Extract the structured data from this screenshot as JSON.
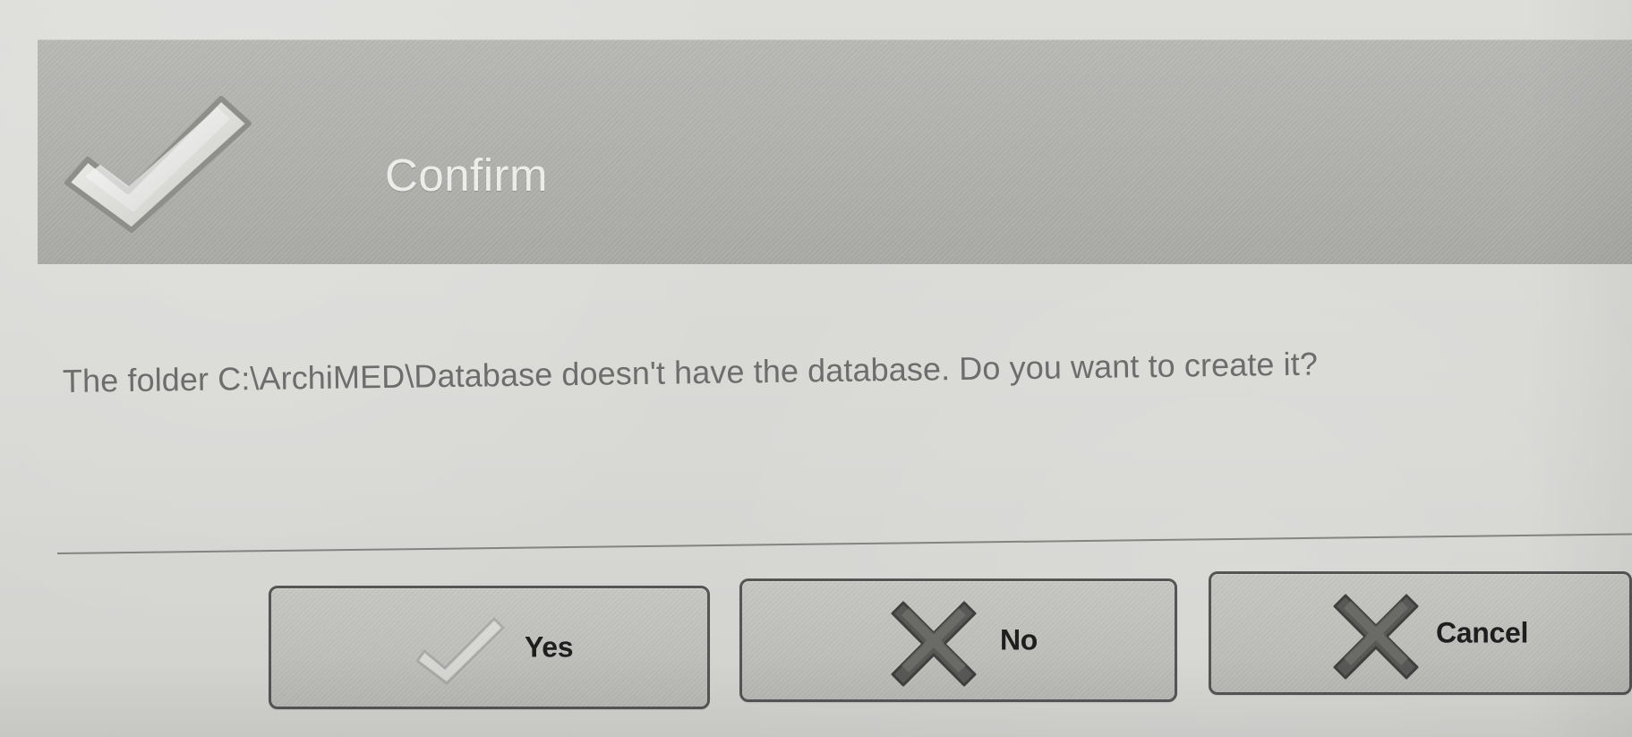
{
  "dialog": {
    "title": "Confirm",
    "message": "The folder C:\\ArchiMED\\Database doesn't have the database. Do you want to create it?"
  },
  "buttons": {
    "yes": "Yes",
    "no": "No",
    "cancel": "Cancel"
  },
  "icons": {
    "header": "checkmark-icon",
    "yes": "checkmark-icon",
    "no": "x-icon",
    "cancel": "x-icon"
  },
  "colors": {
    "header": "#b0b0ad",
    "button_border": "#555555",
    "text": "#1e1e1e",
    "message_text": "#6d6d6d"
  }
}
